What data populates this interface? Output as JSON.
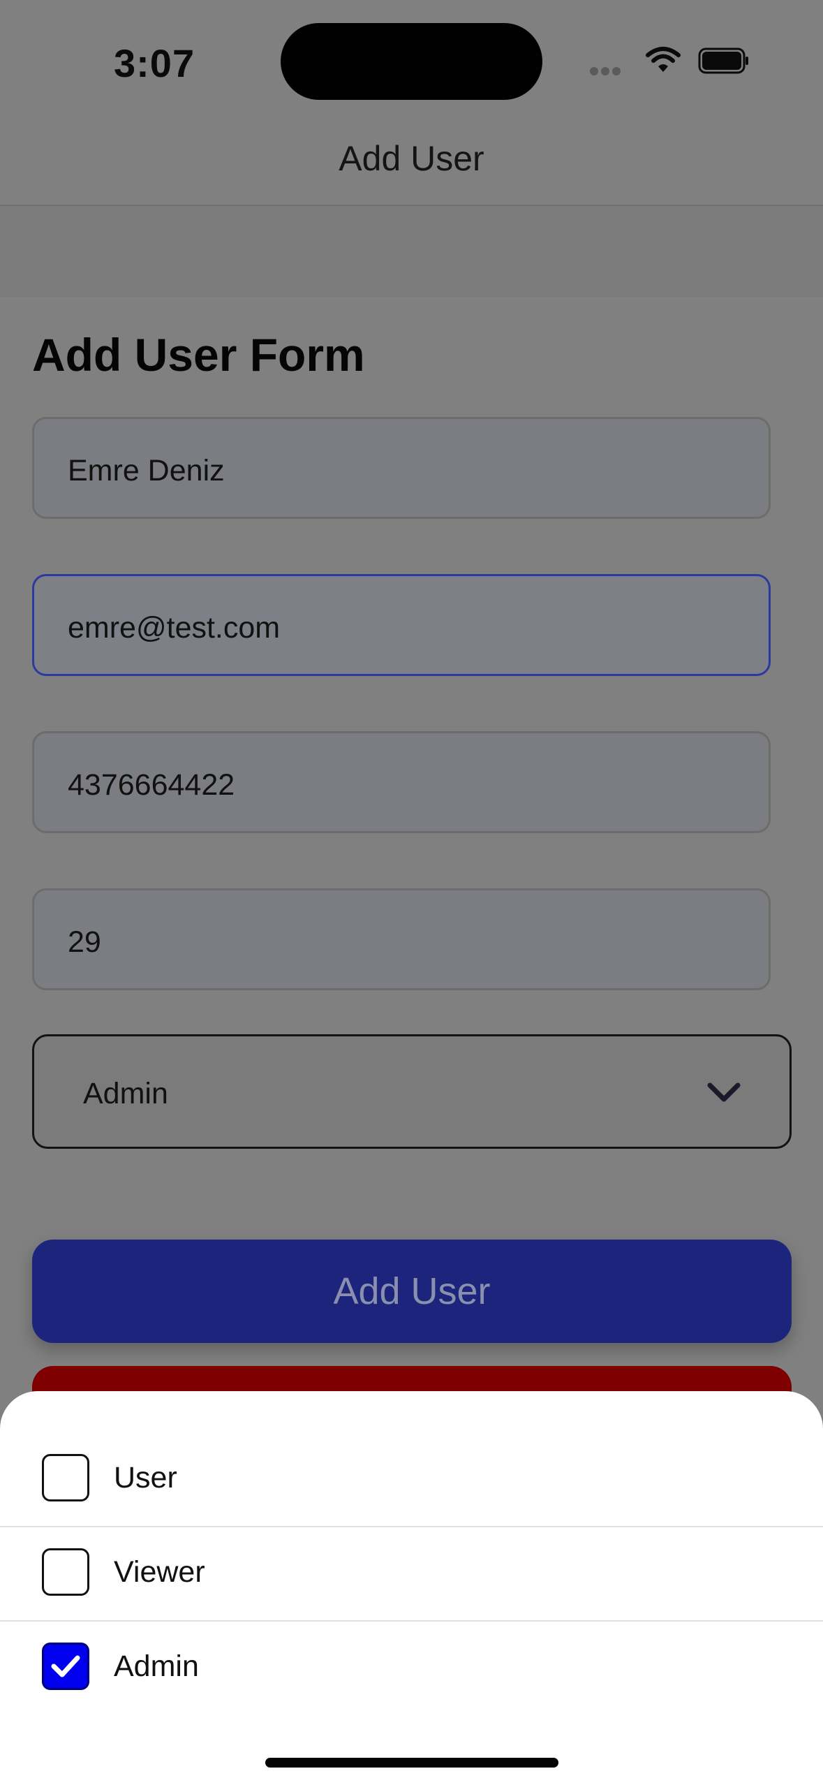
{
  "status_bar": {
    "time": "3:07"
  },
  "nav": {
    "title": "Add User"
  },
  "form": {
    "title": "Add User Form",
    "name_value": "Emre Deniz",
    "email_value": "emre@test.com",
    "phone_value": "4376664422",
    "age_value": "29",
    "role_value": "Admin",
    "add_button_label": "Add User"
  },
  "sheet": {
    "options": [
      {
        "label": "User",
        "checked": false
      },
      {
        "label": "Viewer",
        "checked": false
      },
      {
        "label": "Admin",
        "checked": true
      }
    ]
  },
  "colors": {
    "accent": "#1c257b",
    "checkbox_checked": "#0000ee",
    "destructive": "#7e0000"
  }
}
